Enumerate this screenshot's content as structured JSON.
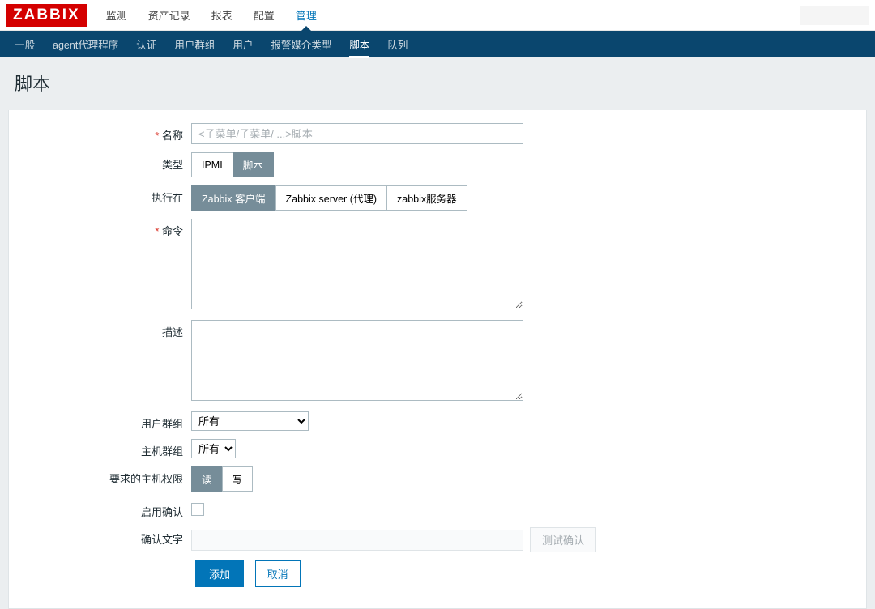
{
  "logo": "ZABBIX",
  "mainnav": {
    "items": [
      {
        "label": "监测"
      },
      {
        "label": "资产记录"
      },
      {
        "label": "报表"
      },
      {
        "label": "配置"
      },
      {
        "label": "管理",
        "active": true
      }
    ]
  },
  "subnav": {
    "items": [
      {
        "label": "一般"
      },
      {
        "label": "agent代理程序"
      },
      {
        "label": "认证"
      },
      {
        "label": "用户群组"
      },
      {
        "label": "用户"
      },
      {
        "label": "报警媒介类型"
      },
      {
        "label": "脚本",
        "active": true
      },
      {
        "label": "队列"
      }
    ]
  },
  "page_title": "脚本",
  "form": {
    "name_label": "名称",
    "name_placeholder": "<子菜单/子菜单/ ...>脚本",
    "type_label": "类型",
    "type_options": [
      "IPMI",
      "脚本"
    ],
    "type_selected": "脚本",
    "execute_on_label": "执行在",
    "execute_on_options": [
      "Zabbix 客户端",
      "Zabbix server (代理)",
      "zabbix服务器"
    ],
    "execute_on_selected": "Zabbix 客户端",
    "commands_label": "命令",
    "description_label": "描述",
    "user_group_label": "用户群组",
    "user_group_value": "所有",
    "host_group_label": "主机群组",
    "host_group_value": "所有",
    "host_perm_label": "要求的主机权限",
    "host_perm_options": [
      "读",
      "写"
    ],
    "host_perm_selected": "读",
    "enable_confirm_label": "启用确认",
    "confirm_text_label": "确认文字",
    "test_confirm_btn": "测试确认",
    "add_btn": "添加",
    "cancel_btn": "取消"
  }
}
